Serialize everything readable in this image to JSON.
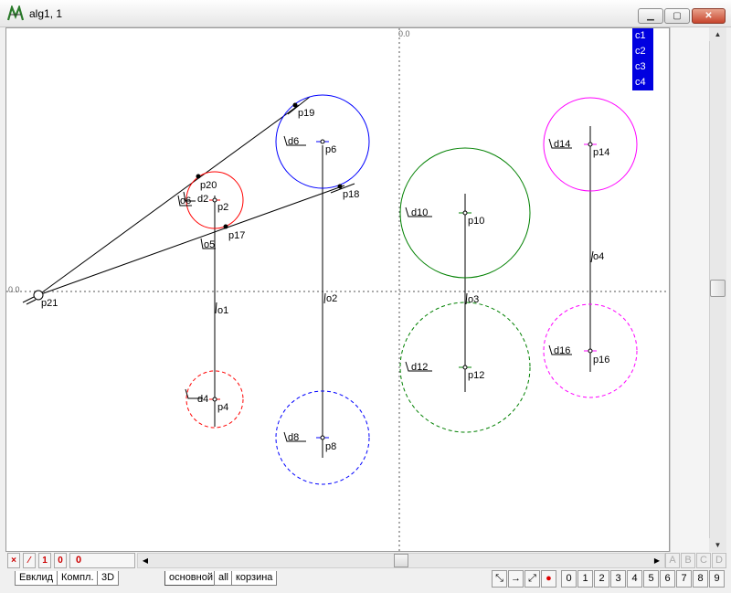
{
  "window": {
    "title": "alg1, 1",
    "min_icon": "minimize-icon",
    "max_icon": "maximize-icon",
    "close_icon": "close-icon",
    "app_icon": "app-logo-icon"
  },
  "canvas": {
    "axis_label_x": "0.0",
    "axis_label_y": "0.0",
    "layers": [
      "c1",
      "c2",
      "c3",
      "c4"
    ],
    "point_labels": [
      "p2",
      "p4",
      "p6",
      "p8",
      "p10",
      "p12",
      "p14",
      "p16",
      "p17",
      "p18",
      "p19",
      "p20",
      "p21"
    ],
    "circle_labels": [
      "d2",
      "d4",
      "d6",
      "d8",
      "d10",
      "d12",
      "d14",
      "d16"
    ],
    "line_labels": [
      "o1",
      "o2",
      "o3",
      "o4",
      "o5",
      "o6"
    ],
    "colors": {
      "red": "#ff0000",
      "blue": "#0000ff",
      "green": "#008000",
      "magenta": "#ff00ff",
      "layer_bg": "#0000e0"
    }
  },
  "status": {
    "buttons": [
      "×",
      "⁄",
      "1",
      "0"
    ],
    "count": "0"
  },
  "tabs": [
    "Евклид",
    "Компл.",
    "3D",
    "основной",
    "all",
    "корзина"
  ],
  "side_letters": [
    "A",
    "B",
    "C",
    "D"
  ],
  "tools": [
    "⤡",
    "→",
    "⤢",
    "●"
  ],
  "digits": [
    "0",
    "1",
    "2",
    "3",
    "4",
    "5",
    "6",
    "7",
    "8",
    "9",
    "↑"
  ]
}
